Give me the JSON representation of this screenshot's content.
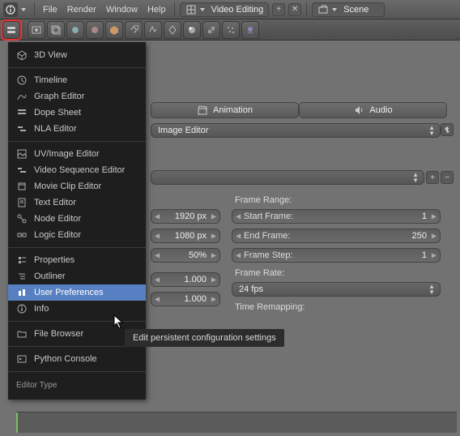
{
  "top_menu": {
    "items": [
      "File",
      "Render",
      "Window",
      "Help"
    ],
    "mode_label": "Video Editing",
    "scene_label": "Scene"
  },
  "editor_menu": {
    "groups": [
      [
        "3D View"
      ],
      [
        "Timeline",
        "Graph Editor",
        "Dope Sheet",
        "NLA Editor"
      ],
      [
        "UV/Image Editor",
        "Video Sequence Editor",
        "Movie Clip Editor",
        "Text Editor",
        "Node Editor",
        "Logic Editor"
      ],
      [
        "Properties",
        "Outliner",
        "User Preferences",
        "Info"
      ],
      [
        "File Browser"
      ],
      [
        "Python Console"
      ]
    ],
    "highlighted": "User Preferences",
    "footer": "Editor Type"
  },
  "tooltip": "Edit persistent configuration settings",
  "tabs": {
    "animation": "Animation",
    "audio": "Audio"
  },
  "display_dropdown": "Image Editor",
  "dimensions": {
    "res_x": "1920 px",
    "res_y": "1080 px",
    "res_pct": "50%",
    "aspect_x": "1.000",
    "aspect_y": "1.000"
  },
  "frame_range": {
    "header": "Frame Range:",
    "start_label": "Start Frame:",
    "start_val": "1",
    "end_label": "End Frame:",
    "end_val": "250",
    "step_label": "Frame Step:",
    "step_val": "1"
  },
  "frame_rate": {
    "header": "Frame Rate:",
    "value": "24 fps",
    "remap_label": "Time Remapping:"
  }
}
